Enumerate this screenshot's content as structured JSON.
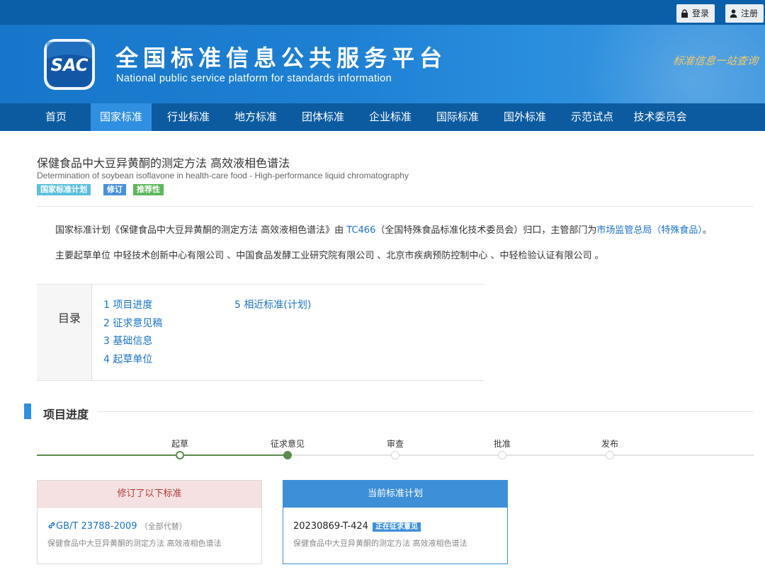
{
  "topbar": {
    "login_label": "登录",
    "register_label": "注册"
  },
  "banner": {
    "logo_text": "SAC",
    "title": "全国标准信息公共服务平台",
    "subtitle": "National public service platform  for standards information",
    "slogan": "标准信息一站查询"
  },
  "nav": {
    "items": [
      "首页",
      "国家标准",
      "行业标准",
      "地方标准",
      "团体标准",
      "企业标准",
      "国际标准",
      "国外标准",
      "示范试点",
      "技术委员会"
    ],
    "active_index": 1
  },
  "doc": {
    "title": "保健食品中大豆异黄酮的测定方法 高效液相色谱法",
    "title_en": "Determination of soybean isoflavone in health-care food - High-performance liquid chromatography",
    "badges": [
      {
        "label": "国家标准计划",
        "color": "#5bc0de"
      },
      {
        "label": "修订",
        "color": "#4a90d9"
      },
      {
        "label": "推荐性",
        "color": "#5cb85c"
      }
    ]
  },
  "intro": {
    "p1_prefix": "国家标准计划《保健食品中大豆异黄酮的测定方法 高效液相色谱法》由 ",
    "p1_tc": "TC466",
    "p1_mid": "（全国特殊食品标准化技术委员会）归口，主管部门为",
    "p1_dept": "市场监管总局（特殊食品）",
    "p1_end": "。",
    "p2": "主要起草单位 中轻技术创新中心有限公司 、中国食品发酵工业研究院有限公司 、北京市疾病预防控制中心 、中轻检验认证有限公司 。"
  },
  "toc": {
    "title": "目录",
    "items": [
      "1  项目进度",
      "2  征求意见稿",
      "3  基础信息",
      "4  起草单位",
      "5  相近标准(计划)"
    ]
  },
  "progress": {
    "section_title": "项目进度",
    "steps": [
      "起草",
      "征求意见",
      "审查",
      "批准",
      "发布"
    ],
    "completed_count": 2,
    "current_index": 1
  },
  "cards": {
    "revised": {
      "header": "修订了以下标准",
      "code": "GB/T 23788-2009",
      "note": "（全部代替）",
      "name": "保健食品中大豆异黄酮的测定方法 高效液相色谱法"
    },
    "current": {
      "header": "当前标准计划",
      "code": "20230869-T-424",
      "status": "正在征求意见",
      "name": "保健食品中大豆异黄酮的测定方法 高效液相色谱法"
    }
  },
  "colors": {
    "nav_bg": "#0c5ba1",
    "nav_active": "#2f8fe0",
    "link": "#1a73c9",
    "progress_done": "#5b8b4c",
    "revised_header_bg": "#f5e1e1",
    "revised_header_text": "#b33a3a",
    "current_header_bg": "#3d8fd8"
  }
}
